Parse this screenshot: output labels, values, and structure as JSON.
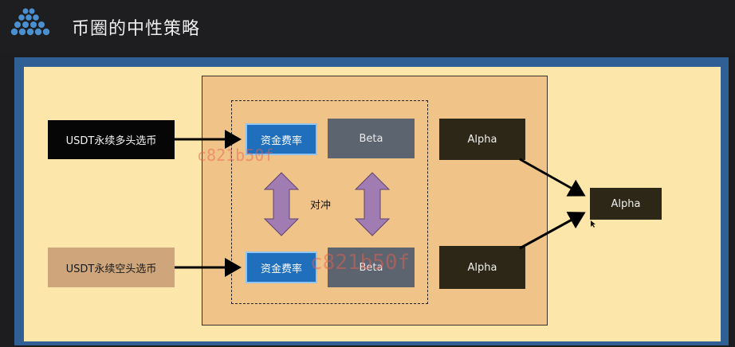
{
  "header": {
    "title": "币圈的中性策略"
  },
  "diagram": {
    "sources": {
      "long": "USDT永续多头选币",
      "short": "USDT永续空头选币"
    },
    "funding_rate_label": "资金费率",
    "beta_label": "Beta",
    "alpha_label": "Alpha",
    "hedge_label": "对冲",
    "watermark": "c821b50f"
  },
  "colors": {
    "panel_bg": "#fde6aa",
    "frame": "#2f5f94",
    "outer_box": "#f0c488",
    "funding_box": "#1f6fbd",
    "beta_box": "#5c6470",
    "alpha_box": "#2d2718",
    "hedge_arrow": "#a17cb2"
  }
}
